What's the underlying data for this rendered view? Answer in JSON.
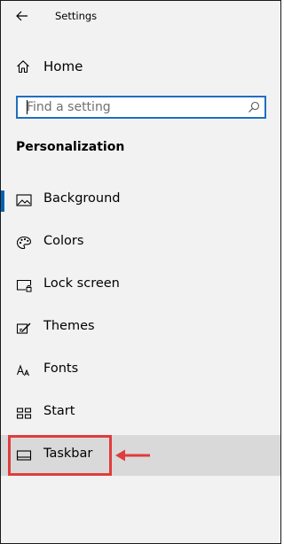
{
  "window": {
    "title": "Settings"
  },
  "home": {
    "label": "Home"
  },
  "search": {
    "placeholder": "Find a setting"
  },
  "section": {
    "title": "Personalization"
  },
  "nav": {
    "items": [
      {
        "label": "Background",
        "icon": "picture-icon"
      },
      {
        "label": "Colors",
        "icon": "palette-icon"
      },
      {
        "label": "Lock screen",
        "icon": "lock-screen-icon"
      },
      {
        "label": "Themes",
        "icon": "themes-icon"
      },
      {
        "label": "Fonts",
        "icon": "fonts-icon"
      },
      {
        "label": "Start",
        "icon": "start-icon"
      },
      {
        "label": "Taskbar",
        "icon": "taskbar-icon"
      }
    ]
  },
  "colors": {
    "accent": "#0063b1",
    "annotation": "#e03c3c",
    "selected_bg": "#d9d9d9"
  }
}
